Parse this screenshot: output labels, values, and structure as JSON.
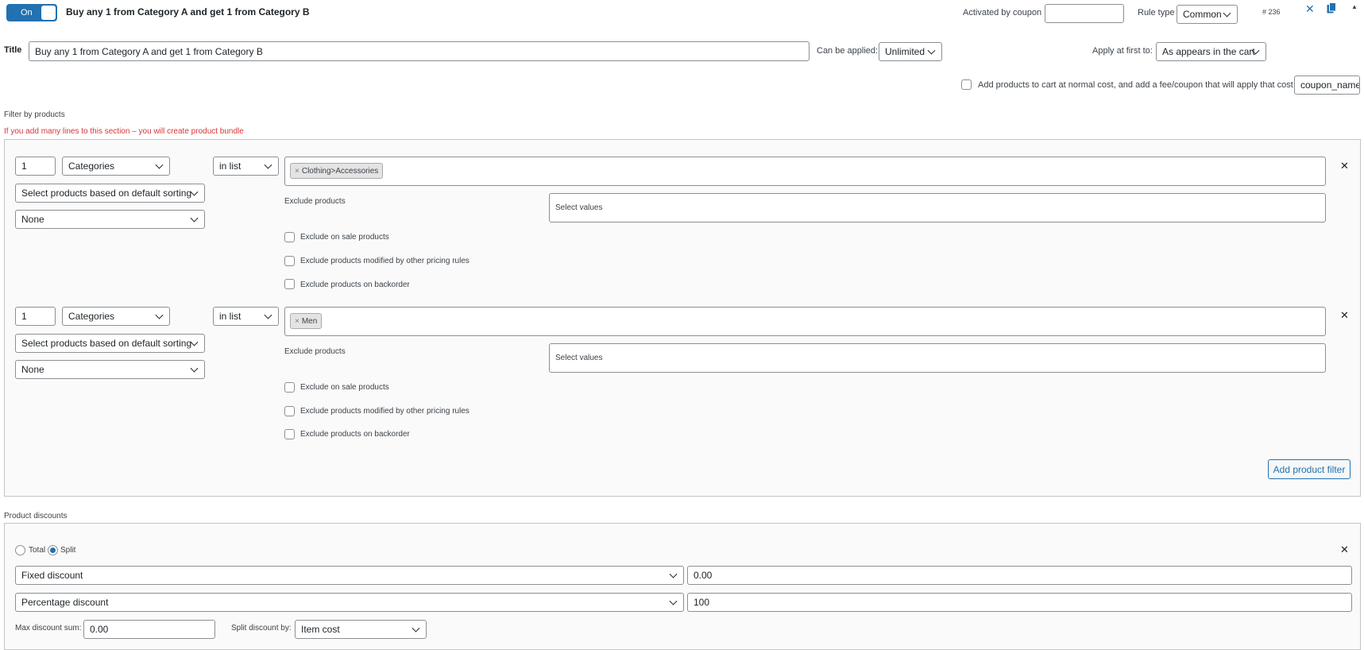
{
  "header": {
    "toggle_label": "On",
    "rule_title": "Buy any 1 from Category A and get 1 from Category B",
    "activated_by_coupon_label": "Activated by coupon",
    "activated_by_coupon_value": "",
    "rule_type_label": "Rule type",
    "rule_type_value": "Common",
    "rule_id": "# 236"
  },
  "title_row": {
    "label": "Title",
    "value": "Buy any 1 from Category A and get 1 from Category B",
    "can_be_applied_label": "Can be applied:",
    "can_be_applied_value": "Unlimited",
    "apply_at_first_label": "Apply at first to:",
    "apply_at_first_value": "As appears in the cart"
  },
  "fee_row": {
    "label": "Add products to cart at normal cost, and add a fee/coupon that will apply that cost",
    "coupon_value": "coupon_name"
  },
  "filter_section": {
    "heading": "Filter by products",
    "warning": "If you add many lines to this section – you will create product bundle",
    "filters": [
      {
        "qty": "1",
        "type": "Categories",
        "sorting": "Select products based on default sorting",
        "none": "None",
        "method": "in list",
        "tag": "Clothing>Accessories",
        "exclude_label": "Exclude products",
        "exclude_placeholder": "Select values",
        "opt_sale": "Exclude on sale products",
        "opt_modified": "Exclude products modified by other pricing rules",
        "opt_backorder": "Exclude products on backorder"
      },
      {
        "qty": "1",
        "type": "Categories",
        "sorting": "Select products based on default sorting",
        "none": "None",
        "method": "in list",
        "tag": "Men",
        "exclude_label": "Exclude products",
        "exclude_placeholder": "Select values",
        "opt_sale": "Exclude on sale products",
        "opt_modified": "Exclude products modified by other pricing rules",
        "opt_backorder": "Exclude products on backorder"
      }
    ],
    "add_button": "Add product filter"
  },
  "discounts": {
    "heading": "Product discounts",
    "total_label": "Total",
    "split_label": "Split",
    "fixed_label": "Fixed discount",
    "fixed_value": "0.00",
    "percentage_label": "Percentage discount",
    "percentage_value": "100",
    "max_sum_label": "Max discount sum:",
    "max_sum_value": "0.00",
    "split_by_label": "Split discount by:",
    "split_by_value": "Item cost"
  },
  "icons": {
    "close": "✕",
    "copy": "copy-icon",
    "collapse": "▲"
  },
  "colors": {
    "accent": "#2271b1",
    "warning": "#d63638"
  }
}
